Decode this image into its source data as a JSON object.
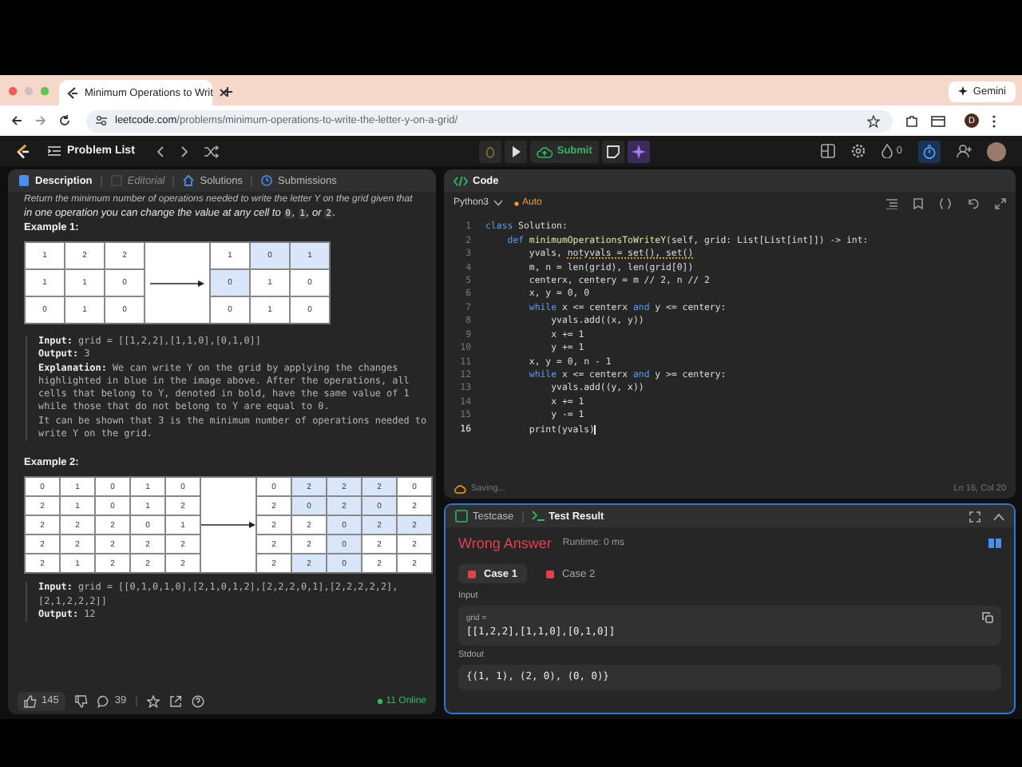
{
  "browser": {
    "tab_title": "Minimum Operations to Writ",
    "gemini": "Gemini",
    "url_host": "leetcode.com",
    "url_path": "/problems/minimum-operations-to-write-the-letter-y-on-a-grid/",
    "profile": "D"
  },
  "header": {
    "problem_list": "Problem List",
    "submit": "Submit",
    "streak": "0"
  },
  "left_tabs": [
    {
      "label": "Description",
      "selected": true,
      "disabled": false
    },
    {
      "label": "Editorial",
      "selected": false,
      "disabled": true
    },
    {
      "label": "Solutions",
      "selected": false,
      "disabled": false
    },
    {
      "label": "Submissions",
      "selected": false,
      "disabled": false
    }
  ],
  "description": {
    "intro": "Return the minimum number of operations needed to write the letter Y on the grid given that",
    "statement": [
      {
        "kind": "text",
        "text": "in one operation you can change the value at any cell to "
      },
      {
        "kind": "code",
        "text": "0"
      },
      {
        "kind": "text",
        "text": ", "
      },
      {
        "kind": "code",
        "text": "1"
      },
      {
        "kind": "text",
        "text": ", or "
      },
      {
        "kind": "code",
        "text": "2"
      },
      {
        "kind": "text",
        "text": "."
      }
    ],
    "examples": [
      {
        "title": "Example 1:",
        "before": [
          [
            "1",
            "2",
            "2"
          ],
          [
            "1",
            "1",
            "0"
          ],
          [
            "0",
            "1",
            "0"
          ]
        ],
        "after": [
          [
            {
              "value": "1",
              "changed": false
            },
            {
              "value": "0",
              "changed": true
            },
            {
              "value": "1",
              "changed": true
            }
          ],
          [
            {
              "value": "0",
              "changed": true
            },
            {
              "value": "1",
              "changed": false
            },
            {
              "value": "0",
              "changed": false
            }
          ],
          [
            {
              "value": "0",
              "changed": false
            },
            {
              "value": "1",
              "changed": false
            },
            {
              "value": "0",
              "changed": false
            }
          ]
        ],
        "lines": [
          {
            "label": "Input:",
            "text": " grid = [[1,2,2],[1,1,0],[0,1,0]]"
          },
          {
            "label": "Output:",
            "text": " 3"
          },
          {
            "label": "Explanation:",
            "text": " We can write Y on the grid by applying the changes highlighted in blue in the image above. After the operations, all cells that belong to Y, denoted in bold, have the same value of 1 while those that do not belong to Y are equal to 0.\nIt can be shown that 3 is the minimum number of operations needed to write Y on the grid."
          }
        ]
      },
      {
        "title": "Example 2:",
        "before": [
          [
            "0",
            "1",
            "0",
            "1",
            "0"
          ],
          [
            "2",
            "1",
            "0",
            "1",
            "2"
          ],
          [
            "2",
            "2",
            "2",
            "0",
            "1"
          ],
          [
            "2",
            "2",
            "2",
            "2",
            "2"
          ],
          [
            "2",
            "1",
            "2",
            "2",
            "2"
          ]
        ],
        "after": [
          [
            {
              "value": "0",
              "changed": false
            },
            {
              "value": "2",
              "changed": true
            },
            {
              "value": "2",
              "changed": true
            },
            {
              "value": "2",
              "changed": true
            },
            {
              "value": "0",
              "changed": false
            }
          ],
          [
            {
              "value": "2",
              "changed": false
            },
            {
              "value": "0",
              "changed": true
            },
            {
              "value": "2",
              "changed": true
            },
            {
              "value": "0",
              "changed": true
            },
            {
              "value": "2",
              "changed": false
            }
          ],
          [
            {
              "value": "2",
              "changed": false
            },
            {
              "value": "2",
              "changed": false
            },
            {
              "value": "0",
              "changed": true
            },
            {
              "value": "2",
              "changed": true
            },
            {
              "value": "2",
              "changed": true
            }
          ],
          [
            {
              "value": "2",
              "changed": false
            },
            {
              "value": "2",
              "changed": false
            },
            {
              "value": "0",
              "changed": true
            },
            {
              "value": "2",
              "changed": false
            },
            {
              "value": "2",
              "changed": false
            }
          ],
          [
            {
              "value": "2",
              "changed": false
            },
            {
              "value": "2",
              "changed": true
            },
            {
              "value": "0",
              "changed": true
            },
            {
              "value": "2",
              "changed": false
            },
            {
              "value": "2",
              "changed": false
            }
          ]
        ],
        "lines": [
          {
            "label": "Input:",
            "text": " grid = [[0,1,0,1,0],[2,1,0,1,2],[2,2,2,0,1],[2,2,2,2,2],[2,1,2,2,2]]"
          },
          {
            "label": "Output:",
            "text": " 12"
          }
        ]
      }
    ]
  },
  "footer": {
    "likes": "145",
    "comments": "39",
    "online": "11 Online"
  },
  "code": {
    "tab": "Code",
    "language": "Python3",
    "mode": "Auto",
    "status": "Saving...",
    "cursor": "Ln 16, Col 20",
    "lines": [
      {
        "number": "1",
        "current": false,
        "tokens": [
          {
            "kind": "keyword",
            "text": "class"
          },
          {
            "kind": "plain",
            "text": " Solution:"
          }
        ]
      },
      {
        "number": "2",
        "current": false,
        "tokens": [
          {
            "kind": "keyword",
            "text": "    def"
          },
          {
            "kind": "func",
            "text": " minimumOperationsToWriteY"
          },
          {
            "kind": "plain",
            "text": "(self, grid: List[List[int]]) -> int:"
          }
        ]
      },
      {
        "number": "3",
        "current": false,
        "tokens": [
          {
            "kind": "plain",
            "text": "        yvals, "
          },
          {
            "kind": "warn",
            "text": "notyvals = set(), set()"
          }
        ]
      },
      {
        "number": "4",
        "current": false,
        "tokens": [
          {
            "kind": "plain",
            "text": "        m, n = len(grid), len(grid[0])"
          }
        ]
      },
      {
        "number": "5",
        "current": false,
        "tokens": [
          {
            "kind": "plain",
            "text": "        centerx, centery = m // 2, n // 2"
          }
        ]
      },
      {
        "number": "6",
        "current": false,
        "tokens": [
          {
            "kind": "plain",
            "text": "        x, y = 0, 0"
          }
        ]
      },
      {
        "number": "7",
        "current": false,
        "tokens": [
          {
            "kind": "keyword",
            "text": "        while"
          },
          {
            "kind": "plain",
            "text": " x <= centerx "
          },
          {
            "kind": "keyword",
            "text": "and"
          },
          {
            "kind": "plain",
            "text": " y <= centery:"
          }
        ]
      },
      {
        "number": "8",
        "current": false,
        "tokens": [
          {
            "kind": "plain",
            "text": "            yvals.add((x, y))"
          }
        ]
      },
      {
        "number": "9",
        "current": false,
        "tokens": [
          {
            "kind": "plain",
            "text": "            x += 1"
          }
        ]
      },
      {
        "number": "10",
        "current": false,
        "tokens": [
          {
            "kind": "plain",
            "text": "            y += 1"
          }
        ]
      },
      {
        "number": "11",
        "current": false,
        "tokens": [
          {
            "kind": "plain",
            "text": "        x, y = 0, n - 1"
          }
        ]
      },
      {
        "number": "12",
        "current": false,
        "tokens": [
          {
            "kind": "keyword",
            "text": "        while"
          },
          {
            "kind": "plain",
            "text": " x <= centerx "
          },
          {
            "kind": "keyword",
            "text": "and"
          },
          {
            "kind": "plain",
            "text": " y >= centery:"
          }
        ]
      },
      {
        "number": "13",
        "current": false,
        "tokens": [
          {
            "kind": "plain",
            "text": "            yvals.add((y, x))"
          }
        ]
      },
      {
        "number": "14",
        "current": false,
        "tokens": [
          {
            "kind": "plain",
            "text": "            x += 1"
          }
        ]
      },
      {
        "number": "15",
        "current": false,
        "tokens": [
          {
            "kind": "plain",
            "text": "            y -= 1"
          }
        ]
      },
      {
        "number": "16",
        "current": true,
        "tokens": [
          {
            "kind": "plain",
            "text": "        print(yvals)"
          }
        ]
      }
    ]
  },
  "test": {
    "tabs": [
      {
        "label": "Testcase",
        "selected": false
      },
      {
        "label": "Test Result",
        "selected": true
      }
    ],
    "verdict": "Wrong Answer",
    "runtime": "Runtime: 0 ms",
    "cases": [
      {
        "label": "Case 1",
        "selected": true,
        "passed": false
      },
      {
        "label": "Case 2",
        "selected": false,
        "passed": false
      }
    ],
    "input_label": "Input",
    "param": "grid =",
    "value": "[[1,2,2],[1,1,0],[0,1,0]]",
    "stdout_label": "Stdout",
    "stdout": "{(1, 1), (2, 0), (0, 0)}"
  }
}
